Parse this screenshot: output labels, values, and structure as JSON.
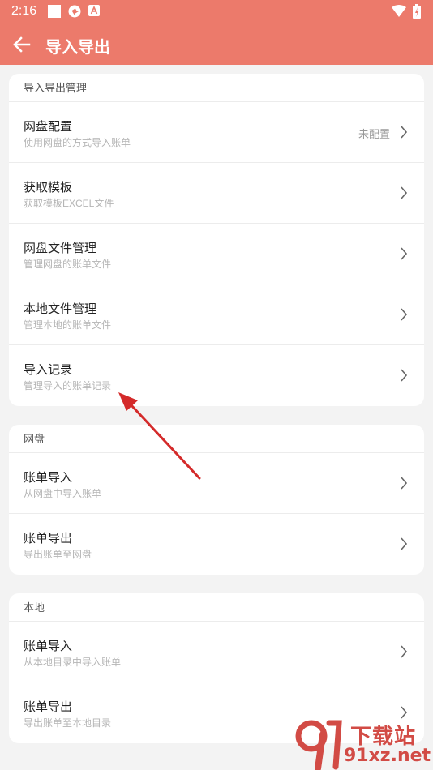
{
  "status_bar": {
    "time": "2:16",
    "left_icons": [
      "square-icon",
      "pinwheel-icon",
      "a-badge-icon"
    ],
    "right_icons": [
      "wifi-icon",
      "battery-icon"
    ]
  },
  "toolbar": {
    "back_icon": "arrow-left-icon",
    "title": "导入导出"
  },
  "sections": [
    {
      "header": "导入导出管理",
      "items": [
        {
          "title": "网盘配置",
          "subtitle": "使用网盘的方式导入账单",
          "value": "未配置"
        },
        {
          "title": "获取模板",
          "subtitle": "获取模板EXCEL文件"
        },
        {
          "title": "网盘文件管理",
          "subtitle": "管理网盘的账单文件"
        },
        {
          "title": "本地文件管理",
          "subtitle": "管理本地的账单文件"
        },
        {
          "title": "导入记录",
          "subtitle": "管理导入的账单记录"
        }
      ]
    },
    {
      "header": "网盘",
      "items": [
        {
          "title": "账单导入",
          "subtitle": "从网盘中导入账单"
        },
        {
          "title": "账单导出",
          "subtitle": "导出账单至网盘"
        }
      ]
    },
    {
      "header": "本地",
      "items": [
        {
          "title": "账单导入",
          "subtitle": "从本地目录中导入账单"
        },
        {
          "title": "账单导出",
          "subtitle": "导出账单至本地目录"
        }
      ]
    }
  ],
  "watermark": {
    "text": "下载站",
    "url": "91xz.net"
  },
  "colors": {
    "accent": "#ec7a6b",
    "annotation_arrow": "#d42a2a"
  }
}
